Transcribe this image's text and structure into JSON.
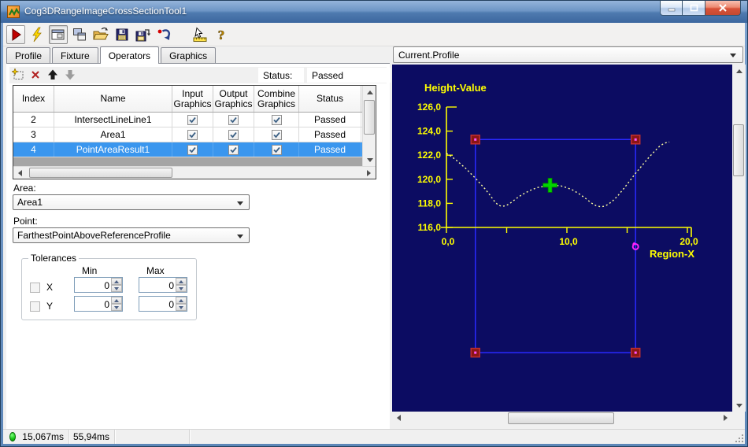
{
  "window": {
    "title": "Cog3DRangeImageCrossSectionTool1"
  },
  "window_buttons": [
    {
      "name": "minimize-button"
    },
    {
      "name": "maximize-button"
    },
    {
      "name": "close-button"
    }
  ],
  "toolbar": {
    "buttons": [
      {
        "name": "run-button",
        "framed": true
      },
      {
        "name": "trigger-button"
      },
      {
        "name": "show-result-toggle",
        "pressed": true
      },
      {
        "name": "float-result-button"
      },
      {
        "name": "open-button"
      },
      {
        "name": "save-button"
      },
      {
        "name": "save-as-button"
      },
      {
        "name": "reset-button"
      },
      {
        "name": "electrode-tool-button",
        "gap": true
      },
      {
        "name": "help-button"
      }
    ]
  },
  "tabs": [
    {
      "label": "Profile",
      "active": false
    },
    {
      "label": "Fixture",
      "active": false
    },
    {
      "label": "Operators",
      "active": true
    },
    {
      "label": "Graphics",
      "active": false
    }
  ],
  "operators": {
    "minibar": {
      "buttons": [
        {
          "name": "add-operator-button"
        },
        {
          "name": "delete-operator-button"
        },
        {
          "name": "move-up-button"
        },
        {
          "name": "move-down-button",
          "disabled": true
        }
      ],
      "status_label": "Status:",
      "status_value": "Passed"
    },
    "table": {
      "columns": [
        "Index",
        "Name",
        "Input Graphics",
        "Output Graphics",
        "Combine Graphics",
        "Status"
      ],
      "rows": [
        {
          "index": "2",
          "name": "IntersectLineLine1",
          "input": true,
          "output": true,
          "combine": true,
          "status": "Passed",
          "selected": false
        },
        {
          "index": "3",
          "name": "Area1",
          "input": true,
          "output": true,
          "combine": true,
          "status": "Passed",
          "selected": false
        },
        {
          "index": "4",
          "name": "PointAreaResult1",
          "input": true,
          "output": true,
          "combine": true,
          "status": "Passed",
          "selected": true
        }
      ]
    },
    "area": {
      "label": "Area:",
      "value": "Area1"
    },
    "point": {
      "label": "Point:",
      "value": "FarthestPointAboveReferenceProfile"
    },
    "tolerances": {
      "legend": "Tolerances",
      "min_header": "Min",
      "max_header": "Max",
      "rows": [
        {
          "label": "X",
          "checked": false,
          "min": "0",
          "max": "0"
        },
        {
          "label": "Y",
          "checked": false,
          "min": "0",
          "max": "0"
        }
      ]
    }
  },
  "display": {
    "selector": "Current.Profile"
  },
  "chart_data": {
    "type": "line",
    "title": "",
    "xlabel": "Region-X",
    "ylabel": "Height-Value",
    "xlim": [
      0,
      20.3
    ],
    "ylim": [
      116,
      126
    ],
    "grid": false,
    "bg_color": "#0c0c62",
    "axis_color": "#ffff00",
    "x_ticks": [
      {
        "v": 0,
        "label": "0,0"
      },
      {
        "v": 5,
        "label": ""
      },
      {
        "v": 10,
        "label": "10,0"
      },
      {
        "v": 15,
        "label": ""
      },
      {
        "v": 20,
        "label": "20,0"
      }
    ],
    "y_ticks": [
      {
        "v": 116,
        "label": "116,0"
      },
      {
        "v": 118,
        "label": "118,0"
      },
      {
        "v": 120,
        "label": "120,0"
      },
      {
        "v": 122,
        "label": "122,0"
      },
      {
        "v": 124,
        "label": "124,0"
      },
      {
        "v": 126,
        "label": "126,0"
      }
    ],
    "series": [
      {
        "name": "profile-curve",
        "color": "#ffffa0",
        "style": "dotted",
        "points": [
          [
            0,
            122.15
          ],
          [
            0.4,
            121.9
          ],
          [
            0.8,
            121.6
          ],
          [
            1.2,
            121.25
          ],
          [
            1.6,
            120.9
          ],
          [
            2,
            120.5
          ],
          [
            2.4,
            120.1
          ],
          [
            2.8,
            119.65
          ],
          [
            3.2,
            119.2
          ],
          [
            3.6,
            118.7
          ],
          [
            4,
            118.15
          ],
          [
            4.3,
            117.85
          ],
          [
            4.6,
            117.75
          ],
          [
            4.9,
            117.8
          ],
          [
            5.2,
            117.95
          ],
          [
            5.6,
            118.25
          ],
          [
            6,
            118.55
          ],
          [
            6.5,
            118.85
          ],
          [
            7,
            119.1
          ],
          [
            7.5,
            119.3
          ],
          [
            8,
            119.4
          ],
          [
            8.5,
            119.48
          ],
          [
            9,
            119.5
          ],
          [
            9.5,
            119.45
          ],
          [
            10,
            119.3
          ],
          [
            10.5,
            119.1
          ],
          [
            11,
            118.8
          ],
          [
            11.5,
            118.45
          ],
          [
            12,
            118.05
          ],
          [
            12.4,
            117.82
          ],
          [
            12.8,
            117.72
          ],
          [
            13.1,
            117.75
          ],
          [
            13.4,
            117.9
          ],
          [
            13.8,
            118.2
          ],
          [
            14.2,
            118.6
          ],
          [
            14.7,
            119.2
          ],
          [
            15.2,
            119.85
          ],
          [
            15.7,
            120.5
          ],
          [
            16.2,
            121.1
          ],
          [
            16.7,
            121.7
          ],
          [
            17.2,
            122.25
          ],
          [
            17.7,
            122.75
          ],
          [
            18.1,
            123.0
          ],
          [
            18.5,
            123.1
          ]
        ]
      }
    ],
    "region": {
      "name": "area-search-region",
      "color": "#2a2aff",
      "x1": 2.4,
      "x2": 15.7,
      "y_top": 123.3,
      "y_bottom": 105.6,
      "corner_color": "#8b1515",
      "corner_edge_color": "#c03030",
      "corner_dot_color": "#ff55ff"
    },
    "markers": [
      {
        "name": "result-point-cross",
        "type": "cross",
        "x": 8.6,
        "y": 119.5,
        "color": "#00d400"
      },
      {
        "name": "region-rotation-handle",
        "type": "rotation",
        "x": 15.7,
        "y": 114.4,
        "color": "#ff22ff"
      }
    ]
  },
  "statusbar": {
    "values": [
      "15,067ms",
      "55,94ms"
    ]
  }
}
